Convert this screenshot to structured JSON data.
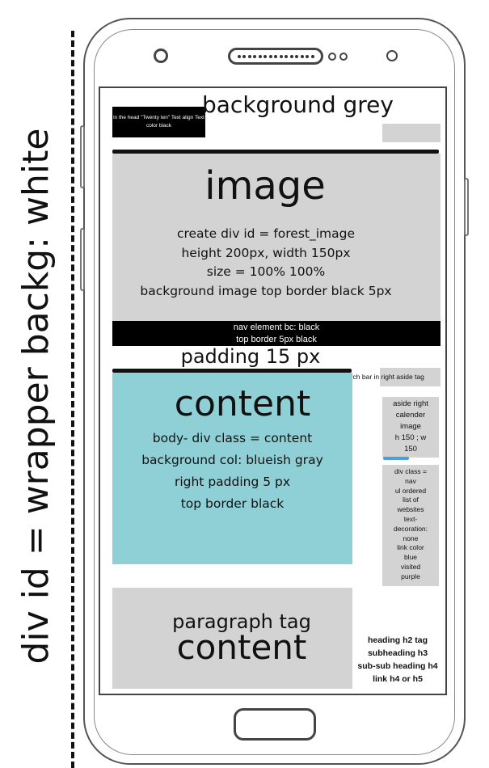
{
  "wrapper_label": "div id = wrapper  backg: white",
  "header": {
    "title": "background grey",
    "logo_note": "in the head  \"Twenty ten\" Text align Text color black"
  },
  "banner": {
    "title": "image",
    "lines": [
      "create div id = forest_image",
      "height 200px, width 150px",
      "size = 100% 100%",
      "background image top border black 5px"
    ]
  },
  "nav": {
    "line1": "nav element bc: black",
    "line2": "top border 5px black"
  },
  "padding_note": "padding 15 px",
  "search_note": "search bar in right aside tag",
  "content": {
    "title": "content",
    "lines": [
      "body- div class = content",
      "background col: blueish gray",
      "right padding 5 px",
      "top border black"
    ]
  },
  "aside_calendar": [
    "aside right",
    "calender",
    "image",
    "h 150 ; w",
    "150"
  ],
  "aside_nav": [
    "div class =",
    "nav",
    "ul ordered",
    "list of",
    "websites",
    "text-",
    "decoration:",
    "none",
    "link color",
    "blue",
    "visited",
    "purple"
  ],
  "paragraph": {
    "line1": "paragraph tag",
    "line2": "content"
  },
  "headings": [
    "heading h2 tag",
    "subheading h3",
    "sub-sub heading h4",
    "link h4 or h5"
  ],
  "colors": {
    "grey_block": "#d3d3d3",
    "content_bg": "#8fd0d6",
    "progress_bar": "#4a9fe0"
  }
}
